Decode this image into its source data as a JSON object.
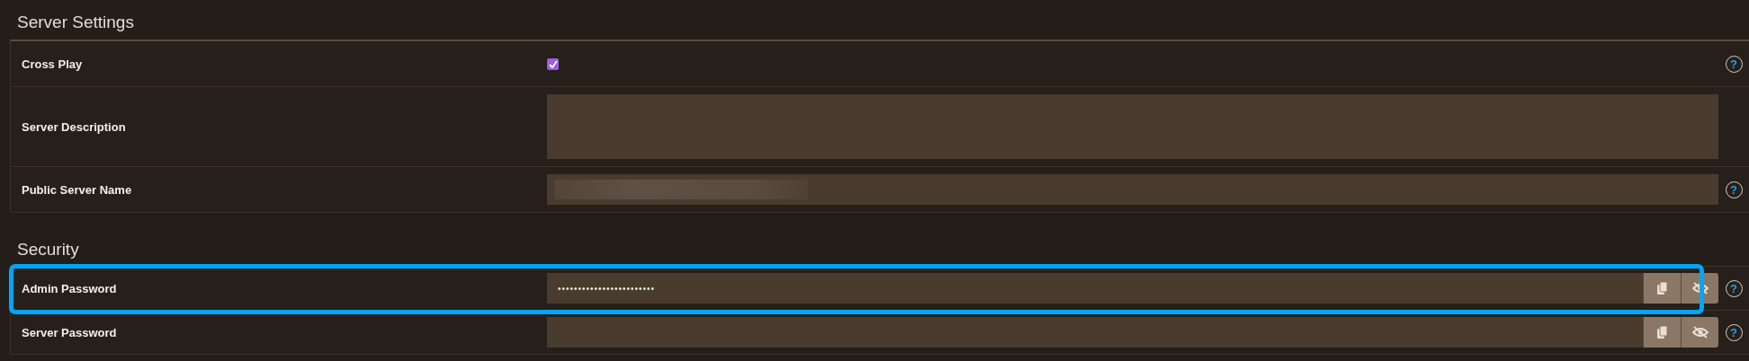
{
  "sections": [
    {
      "title": "Server Settings",
      "rows": [
        {
          "kind": "checkbox",
          "label": "Cross Play",
          "checked": true,
          "help": "?",
          "highlighted": false
        },
        {
          "kind": "textarea",
          "label": "Server Description",
          "highlighted": false
        },
        {
          "kind": "text",
          "label": "Public Server Name",
          "blurred": true,
          "help": "?",
          "highlighted": false
        }
      ]
    },
    {
      "title": "Security",
      "rows": [
        {
          "kind": "password",
          "label": "Admin Password",
          "value": "••••••••••••••••••••••••",
          "help": "?",
          "highlighted": true
        },
        {
          "kind": "password",
          "label": "Server Password",
          "help": "?",
          "highlighted": false
        }
      ]
    }
  ]
}
